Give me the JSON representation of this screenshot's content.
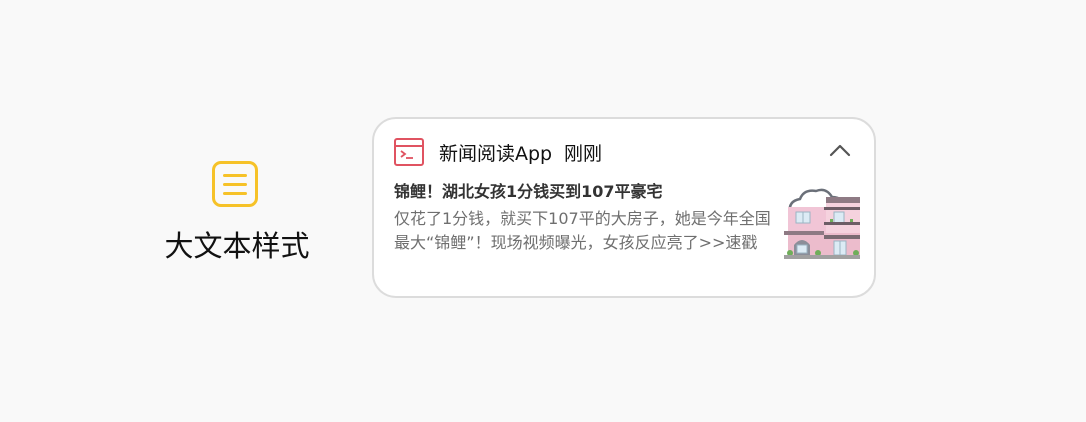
{
  "style_option": {
    "icon": "list-icon",
    "label": "大文本样式",
    "accent_color": "#f6c228"
  },
  "notification": {
    "app_icon": "terminal-icon",
    "app_icon_color": "#e05361",
    "app_name": "新闻阅读App",
    "timestamp": "刚刚",
    "collapse_icon": "chevron-up-icon",
    "title": "锦鲤！湖北女孩1分钱买到107平豪宅",
    "body": "仅花了1分钱，就买下107平的大房子，她是今年全国最大“锦鲤”！现场视频曝光，女孩反应亮了>>速戳",
    "thumbnail": "house-image"
  }
}
